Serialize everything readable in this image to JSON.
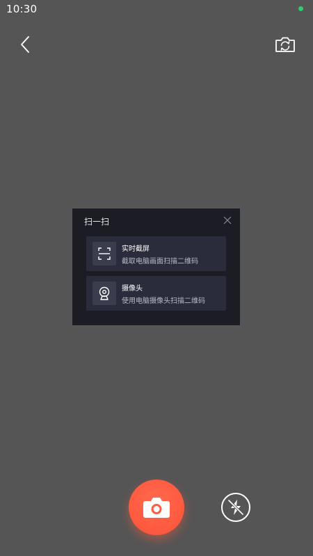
{
  "status_bar": {
    "time": "10:30",
    "indicator_color": "#2ecc71"
  },
  "toolbar": {
    "back_icon": "chevron-left-icon",
    "switch_camera_icon": "camera-switch-icon"
  },
  "dialog": {
    "title": "扫一扫",
    "close_icon": "close-icon",
    "options": [
      {
        "title": "实时截屏",
        "desc": "截取电脑画面扫描二维码",
        "icon": "scan-frame-icon"
      },
      {
        "title": "摄像头",
        "desc": "使用电脑摄像头扫描二维码",
        "icon": "webcam-icon"
      }
    ]
  },
  "controls": {
    "capture_icon": "camera-icon",
    "flash_icon": "flash-off-icon",
    "capture_color": "#ff5b40"
  }
}
